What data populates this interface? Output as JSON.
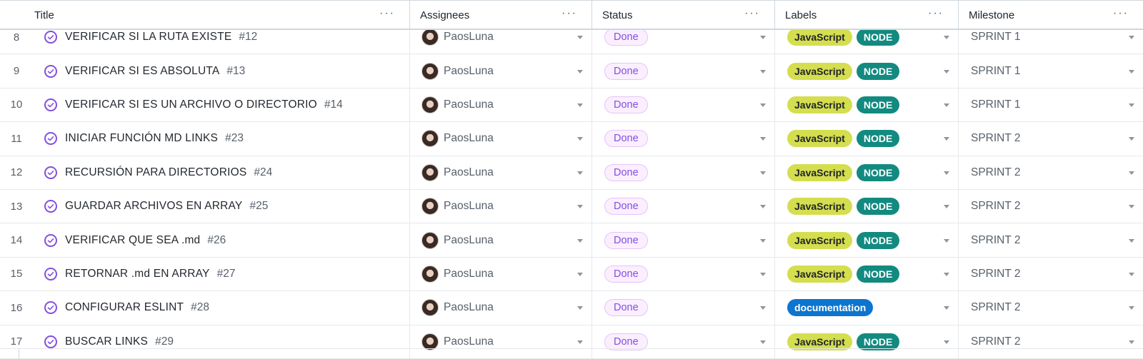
{
  "columns": [
    {
      "key": "title",
      "label": "Title"
    },
    {
      "key": "assignees",
      "label": "Assignees"
    },
    {
      "key": "status",
      "label": "Status"
    },
    {
      "key": "labels",
      "label": "Labels"
    },
    {
      "key": "milestone",
      "label": "Milestone"
    }
  ],
  "menu_icon": "more-horizontal-icon",
  "colors": {
    "status_done": "#8250df",
    "label_js": "#d4de4f",
    "label_node": "#138a80",
    "label_doc": "#0b75cf"
  },
  "rows": [
    {
      "num": "8",
      "title": "VERIFICAR SI LA RUTA EXISTE",
      "issue": "#12",
      "assignee": "PaosLuna",
      "status": "Done",
      "labels": [
        "JavaScript",
        "NODE"
      ],
      "milestone": "SPRINT 1"
    },
    {
      "num": "9",
      "title": "VERIFICAR SI ES ABSOLUTA",
      "issue": "#13",
      "assignee": "PaosLuna",
      "status": "Done",
      "labels": [
        "JavaScript",
        "NODE"
      ],
      "milestone": "SPRINT 1"
    },
    {
      "num": "10",
      "title": "VERIFICAR SI ES UN ARCHIVO O DIRECTORIO",
      "issue": "#14",
      "assignee": "PaosLuna",
      "status": "Done",
      "labels": [
        "JavaScript",
        "NODE"
      ],
      "milestone": "SPRINT 1"
    },
    {
      "num": "11",
      "title": "INICIAR FUNCIÓN MD LINKS",
      "issue": "#23",
      "assignee": "PaosLuna",
      "status": "Done",
      "labels": [
        "JavaScript",
        "NODE"
      ],
      "milestone": "SPRINT 2"
    },
    {
      "num": "12",
      "title": "RECURSIÓN PARA DIRECTORIOS",
      "issue": "#24",
      "assignee": "PaosLuna",
      "status": "Done",
      "labels": [
        "JavaScript",
        "NODE"
      ],
      "milestone": "SPRINT 2"
    },
    {
      "num": "13",
      "title": "GUARDAR ARCHIVOS EN ARRAY",
      "issue": "#25",
      "assignee": "PaosLuna",
      "status": "Done",
      "labels": [
        "JavaScript",
        "NODE"
      ],
      "milestone": "SPRINT 2"
    },
    {
      "num": "14",
      "title": "VERIFICAR QUE SEA .md",
      "issue": "#26",
      "assignee": "PaosLuna",
      "status": "Done",
      "labels": [
        "JavaScript",
        "NODE"
      ],
      "milestone": "SPRINT 2"
    },
    {
      "num": "15",
      "title": "RETORNAR .md EN ARRAY",
      "issue": "#27",
      "assignee": "PaosLuna",
      "status": "Done",
      "labels": [
        "JavaScript",
        "NODE"
      ],
      "milestone": "SPRINT 2"
    },
    {
      "num": "16",
      "title": "CONFIGURAR ESLINT",
      "issue": "#28",
      "assignee": "PaosLuna",
      "status": "Done",
      "labels": [
        "documentation"
      ],
      "milestone": "SPRINT 2"
    },
    {
      "num": "17",
      "title": "BUSCAR LINKS",
      "issue": "#29",
      "assignee": "PaosLuna",
      "status": "Done",
      "labels": [
        "JavaScript",
        "NODE"
      ],
      "milestone": "SPRINT 2"
    }
  ]
}
